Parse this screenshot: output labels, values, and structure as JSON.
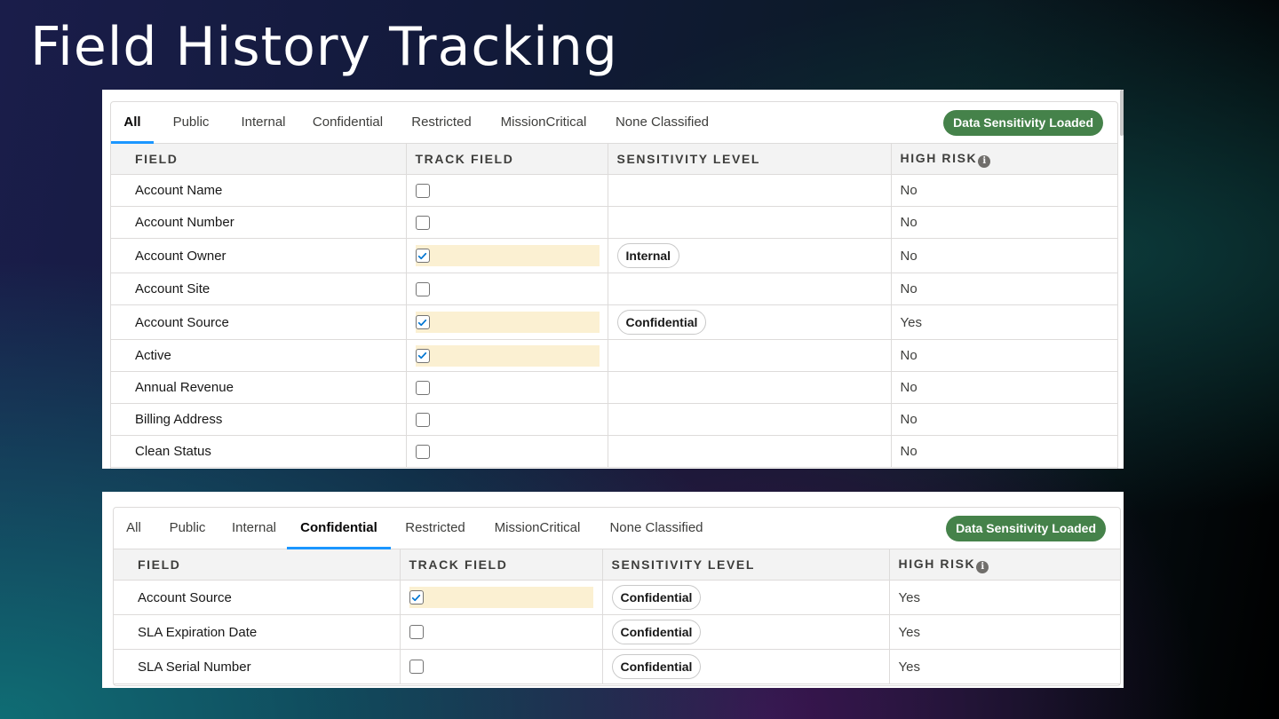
{
  "slide": {
    "title": "Field History Tracking"
  },
  "colors": {
    "accent_tab": "#1b96ff",
    "badge": "#45824a",
    "highlight": "#fbf0d2"
  },
  "panels": [
    {
      "tabs": [
        "All",
        "Public",
        "Internal",
        "Confidential",
        "Restricted",
        "MissionCritical",
        "None Classified"
      ],
      "active_tab": "All",
      "badge": "Data Sensitivity Loaded",
      "columns": {
        "field": "FIELD",
        "track": "TRACK FIELD",
        "sensitivity": "SENSITIVITY LEVEL",
        "risk": "HIGH RISK"
      },
      "info_icon": "info-icon",
      "rows": [
        {
          "field": "Account Name",
          "tracked": false,
          "sensitivity": "",
          "risk": "No"
        },
        {
          "field": "Account Number",
          "tracked": false,
          "sensitivity": "",
          "risk": "No"
        },
        {
          "field": "Account Owner",
          "tracked": true,
          "sensitivity": "Internal",
          "risk": "No"
        },
        {
          "field": "Account Site",
          "tracked": false,
          "sensitivity": "",
          "risk": "No"
        },
        {
          "field": "Account Source",
          "tracked": true,
          "sensitivity": "Confidential",
          "risk": "Yes"
        },
        {
          "field": "Active",
          "tracked": true,
          "sensitivity": "",
          "risk": "No"
        },
        {
          "field": "Annual Revenue",
          "tracked": false,
          "sensitivity": "",
          "risk": "No"
        },
        {
          "field": "Billing Address",
          "tracked": false,
          "sensitivity": "",
          "risk": "No"
        },
        {
          "field": "Clean Status",
          "tracked": false,
          "sensitivity": "",
          "risk": "No"
        }
      ]
    },
    {
      "tabs": [
        "All",
        "Public",
        "Internal",
        "Confidential",
        "Restricted",
        "MissionCritical",
        "None Classified"
      ],
      "active_tab": "Confidential",
      "badge": "Data Sensitivity Loaded",
      "columns": {
        "field": "FIELD",
        "track": "TRACK FIELD",
        "sensitivity": "SENSITIVITY LEVEL",
        "risk": "HIGH RISK"
      },
      "info_icon": "info-icon",
      "rows": [
        {
          "field": "Account Source",
          "tracked": true,
          "sensitivity": "Confidential",
          "risk": "Yes"
        },
        {
          "field": "SLA Expiration Date",
          "tracked": false,
          "sensitivity": "Confidential",
          "risk": "Yes"
        },
        {
          "field": "SLA Serial Number",
          "tracked": false,
          "sensitivity": "Confidential",
          "risk": "Yes"
        }
      ]
    }
  ]
}
